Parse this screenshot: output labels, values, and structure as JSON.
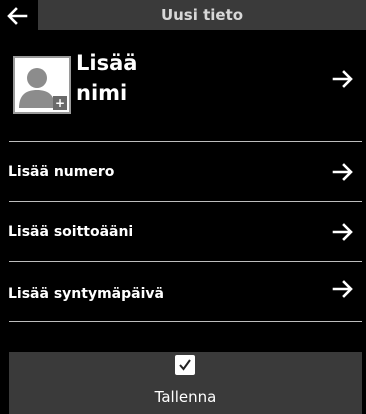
{
  "header": {
    "title": "Uusi tieto"
  },
  "name_entry": {
    "label": "Lisää nimi"
  },
  "rows": [
    {
      "label": "Lisää numero"
    },
    {
      "label": "Lisää soittoääni"
    },
    {
      "label": "Lisää syntymäpäivä"
    }
  ],
  "footer": {
    "save_label": "Tallenna"
  },
  "colors": {
    "background": "#000000",
    "title_bar": "#3a3a3a",
    "footer_bar": "#3a3a3a",
    "divider": "#bdbdbd"
  }
}
